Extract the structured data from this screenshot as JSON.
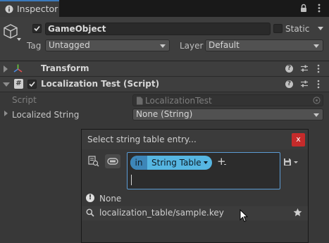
{
  "window": {
    "tab_title": "Inspector"
  },
  "header": {
    "object_name": "GameObject",
    "static_label": "Static",
    "tag_label": "Tag",
    "tag_value": "Untagged",
    "layer_label": "Layer",
    "layer_value": "Default"
  },
  "components": {
    "transform_title": "Transform",
    "localization_title": "Localization Test (Script)"
  },
  "properties": {
    "script_label": "Script",
    "script_value": "LocalizationTest",
    "localized_string_label": "Localized String",
    "localized_string_value": "None (String)"
  },
  "popup": {
    "title": "Select string table entry...",
    "close_glyph": "x",
    "chip_prefix": "in",
    "chip_label": "String Table",
    "add_glyph": "+",
    "search_value": "",
    "results": [
      {
        "icon": "warning-icon",
        "label": "None"
      },
      {
        "icon": "search-icon",
        "label": "localization_table/sample.key"
      }
    ]
  },
  "colors": {
    "accent": "#3a79bb",
    "chip": "#56b6e2",
    "close": "#c52b2b",
    "search_border": "#5b9bd3"
  }
}
